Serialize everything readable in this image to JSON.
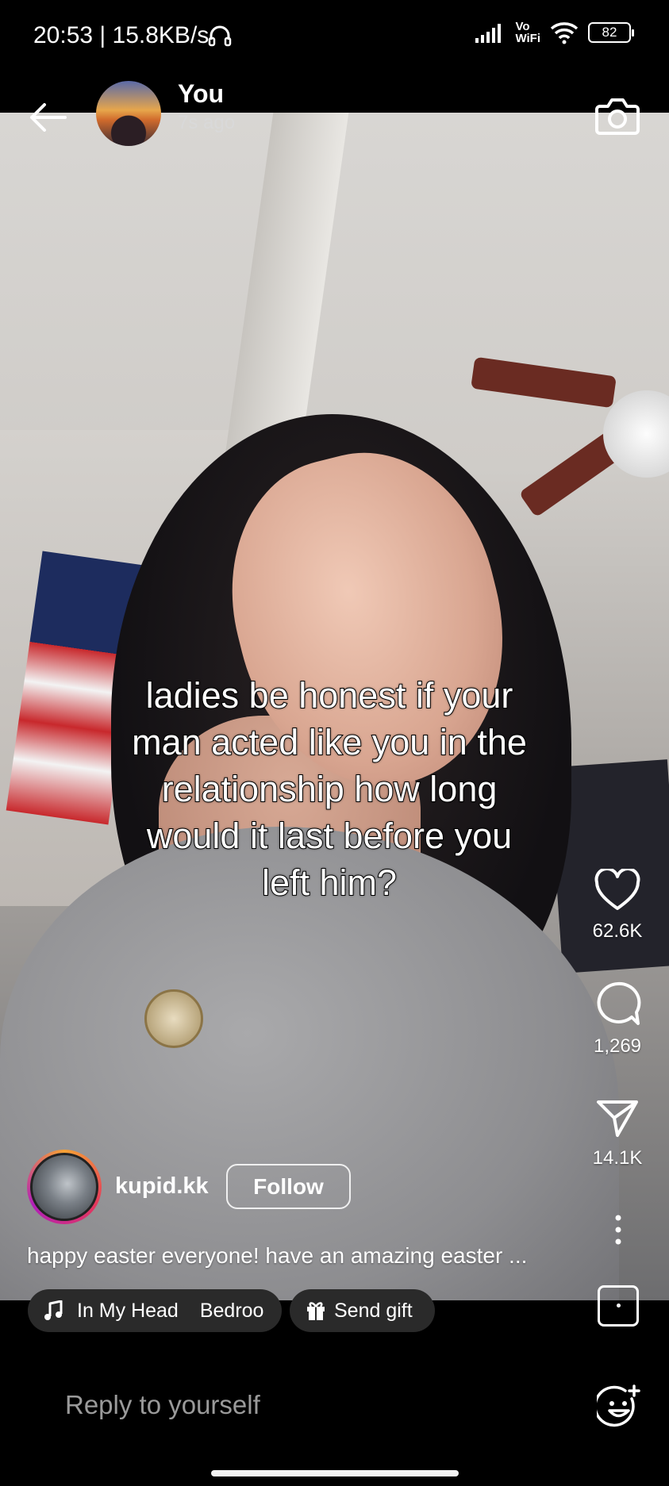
{
  "status_bar": {
    "time_speed": "20:53 | 15.8KB/s",
    "vowifi_top": "Vo",
    "vowifi_bottom": "WiFi",
    "battery": "82"
  },
  "header": {
    "user_name": "You",
    "post_time": "7s ago",
    "icons": [
      "back-arrow-icon",
      "camera-icon"
    ]
  },
  "story": {
    "overlay_text": "ladies be honest if your\nman acted like you in the\nrelationship how long\nwould it last before you\nleft him?"
  },
  "rail": {
    "likes": "62.6K",
    "comments": "1,269",
    "shares": "14.1K"
  },
  "author": {
    "username": "kupid.kk",
    "follow_label": "Follow",
    "caption": "happy easter everyone! have an amazing easter ..."
  },
  "chips": {
    "music_title_1": "In My Head",
    "music_title_2": "Bedroo",
    "gift_label": "Send gift"
  },
  "reply": {
    "placeholder": "Reply to yourself"
  },
  "colors": {
    "background": "#000000",
    "chip_bg": "#2a2a2a",
    "story_ring": [
      "#f7a234",
      "#e4375d",
      "#b11fb8"
    ]
  }
}
